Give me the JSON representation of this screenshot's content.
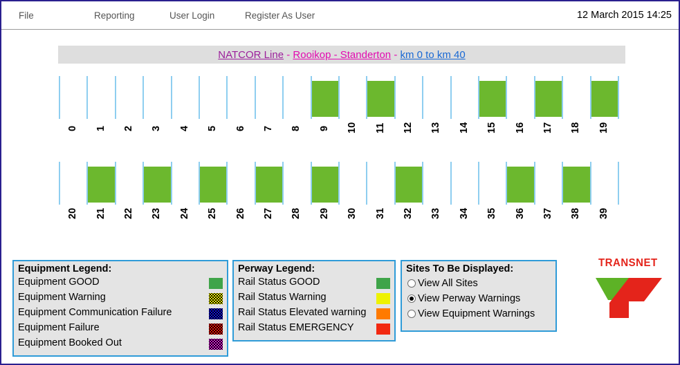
{
  "window": {
    "border_color": "#2a1f8f"
  },
  "menubar": {
    "items": [
      {
        "label": "File",
        "name": "menu-file"
      },
      {
        "label": "Reporting",
        "name": "menu-reporting"
      },
      {
        "label": "User Login",
        "name": "menu-user-login"
      },
      {
        "label": "Register As User",
        "name": "menu-register-as-user"
      }
    ],
    "datetime": "12 March 2015 14:25"
  },
  "title_bar": {
    "line": "NATCOR Line",
    "separator_1": " - ",
    "route": "Rooikop - Standerton",
    "separator_2": " - ",
    "km_range": "km 0 to km 40",
    "line_color": "#9b1f9b",
    "route_color": "#e20ab0",
    "km_color": "#1868d4",
    "background": "#dedede"
  },
  "chart_data": {
    "type": "bar",
    "title": "NATCOR Line - Rooikop - Standerton - km 0 to km 40",
    "xlabel": "",
    "ylabel": "",
    "rows": [
      {
        "row_name": "km-row-0-19",
        "categories": [
          0,
          1,
          2,
          3,
          4,
          5,
          6,
          7,
          8,
          9,
          10,
          11,
          12,
          13,
          14,
          15,
          16,
          17,
          18,
          19
        ],
        "values": [
          0,
          0,
          0,
          0,
          0,
          0,
          0,
          0,
          0,
          1,
          0,
          1,
          0,
          0,
          0,
          1,
          0,
          1,
          0,
          1
        ],
        "highlighted": [
          9,
          11,
          15,
          17,
          19
        ]
      },
      {
        "row_name": "km-row-20-39",
        "categories": [
          20,
          21,
          22,
          23,
          24,
          25,
          26,
          27,
          28,
          29,
          30,
          31,
          32,
          33,
          34,
          35,
          36,
          37,
          38,
          39
        ],
        "values": [
          0,
          1,
          0,
          1,
          0,
          1,
          0,
          1,
          0,
          1,
          0,
          0,
          1,
          0,
          0,
          0,
          1,
          0,
          1,
          0
        ],
        "highlighted": [
          21,
          23,
          25,
          27,
          29,
          32,
          36,
          38
        ]
      }
    ],
    "block_color": "#6cb82e",
    "tick_color": "#8ecef0",
    "grid": true,
    "legend_position": "bottom"
  },
  "equipment_legend": {
    "title": "Equipment Legend:",
    "rows": [
      {
        "label": "Equipment GOOD",
        "color": "#3fa449",
        "pattern": "solid"
      },
      {
        "label": "Equipment Warning",
        "color": "#f2f200",
        "pattern": "dotted"
      },
      {
        "label": "Equipment Communication Failure",
        "color": "#1010e0",
        "pattern": "dotted"
      },
      {
        "label": "Equipment Failure",
        "color": "#ee1206",
        "pattern": "dotted"
      },
      {
        "label": "Equipment Booked Out",
        "color": "#d318d3",
        "pattern": "dotted"
      }
    ]
  },
  "perway_legend": {
    "title": "Perway Legend:",
    "rows": [
      {
        "label": "Rail Status GOOD",
        "color": "#3fa449",
        "pattern": "solid"
      },
      {
        "label": "Rail Status Warning",
        "color": "#eef200",
        "pattern": "solid"
      },
      {
        "label": "Rail Status Elevated warning",
        "color": "#ff7a00",
        "pattern": "solid"
      },
      {
        "label": "Rail Status EMERGENCY",
        "color": "#f22810",
        "pattern": "solid"
      }
    ]
  },
  "sites_panel": {
    "title": "Sites To Be Displayed:",
    "options": [
      {
        "label": "View All Sites",
        "selected": false
      },
      {
        "label": "View Perway Warnings",
        "selected": true
      },
      {
        "label": "View Equipment Warnings",
        "selected": false
      }
    ]
  },
  "logo": {
    "text": "TRANSNET",
    "text_color": "#e4241b",
    "mark_green": "#5db226",
    "mark_red": "#e4241b"
  }
}
